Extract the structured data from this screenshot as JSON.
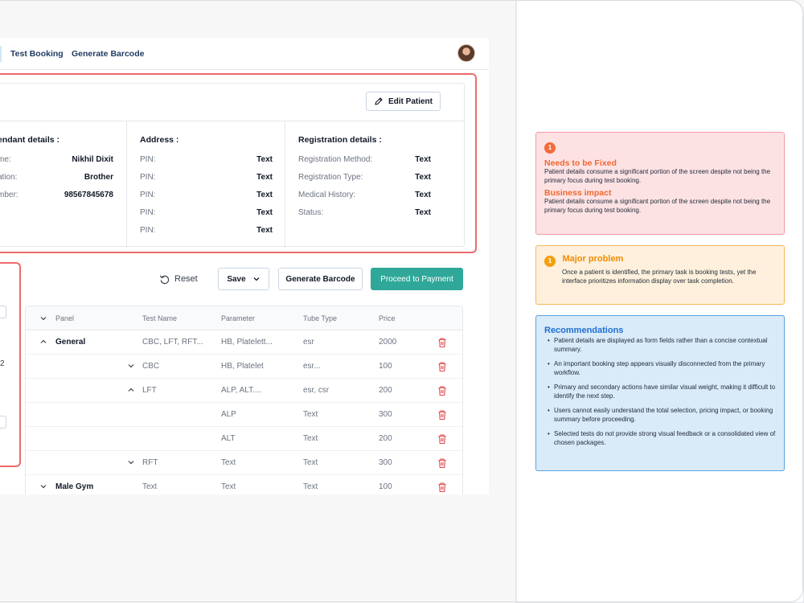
{
  "nav": {
    "tabs": [
      "Test Booking",
      "Generate Barcode"
    ]
  },
  "patient": {
    "edit_label": "Edit Patient",
    "attendant": {
      "title": "endant details :",
      "rows": [
        {
          "k": "me:",
          "v": "Nikhil Dixit"
        },
        {
          "k": "ation:",
          "v": "Brother"
        },
        {
          "k": "mber:",
          "v": "98567845678"
        }
      ]
    },
    "address": {
      "title": "Address :",
      "rows": [
        {
          "k": "PIN:",
          "v": "Text"
        },
        {
          "k": "PIN:",
          "v": "Text"
        },
        {
          "k": "PIN:",
          "v": "Text"
        },
        {
          "k": "PIN:",
          "v": "Text"
        },
        {
          "k": "PIN:",
          "v": "Text"
        }
      ]
    },
    "registration": {
      "title": "Registration details :",
      "rows": [
        {
          "k": "Registration Method:",
          "v": "Text"
        },
        {
          "k": "Registration Type:",
          "v": "Text"
        },
        {
          "k": "Medical History:",
          "v": "Text"
        },
        {
          "k": "Status:",
          "v": "Text"
        }
      ]
    }
  },
  "left_panel": {
    "digit": "2"
  },
  "actions": {
    "reset": "Reset",
    "save": "Save",
    "generate_barcode": "Generate Barcode",
    "proceed": "Proceed to Payment"
  },
  "table": {
    "headers": [
      "Panel",
      "Test Name",
      "Parameter",
      "Tube Type",
      "Price"
    ],
    "rows": [
      {
        "panel": "General",
        "test": "CBC, LFT, RFT...",
        "param": "HB, Platelett...",
        "tube": "esr",
        "price": "2000"
      },
      {
        "panel": "",
        "test": "CBC",
        "param": "HB, Platelet",
        "tube": "esr...",
        "price": "100"
      },
      {
        "panel": "",
        "test": "LFT",
        "param": "ALP, ALT....",
        "tube": "esr, csr",
        "price": "200"
      },
      {
        "panel": "",
        "test": "",
        "param": "ALP",
        "tube": "Text",
        "price": "300"
      },
      {
        "panel": "",
        "test": "",
        "param": "ALT",
        "tube": "Text",
        "price": "200"
      },
      {
        "panel": "",
        "test": "RFT",
        "param": "Text",
        "tube": "Text",
        "price": "300"
      },
      {
        "panel": "Male Gym",
        "test": "Text",
        "param": "Text",
        "tube": "Text",
        "price": "100"
      }
    ]
  },
  "callouts": {
    "fix": {
      "badge": "1",
      "title": "Needs to be Fixed",
      "text": "Patient details consume a significant portion of the screen despite not being the primary focus during test booking.",
      "impact_title": "Business impact",
      "impact_text": "Patient details consume a significant portion of the screen despite not being the primary focus during test booking."
    },
    "major": {
      "badge": "1",
      "title": "Major problem",
      "text": "Once a patient is identified, the primary task is booking tests, yet the interface prioritizes information display over task completion."
    },
    "recommendations": {
      "title": "Recommendations",
      "items": [
        "Patient details are displayed as form fields rather than a concise contextual summary.",
        "An important booking step appears visually disconnected from the primary workflow.",
        "Primary and secondary actions have similar visual weight, making it difficult to identify the next step.",
        "Users cannot easily understand the total selection, pricing impact, or booking summary before proceeding.",
        "Selected tests do not provide strong visual feedback or a consolidated view of chosen packages."
      ]
    }
  },
  "colors": {
    "accent": "#2fa89a",
    "highlight_border": "#ee6b6b",
    "delete": "#e5484d"
  }
}
